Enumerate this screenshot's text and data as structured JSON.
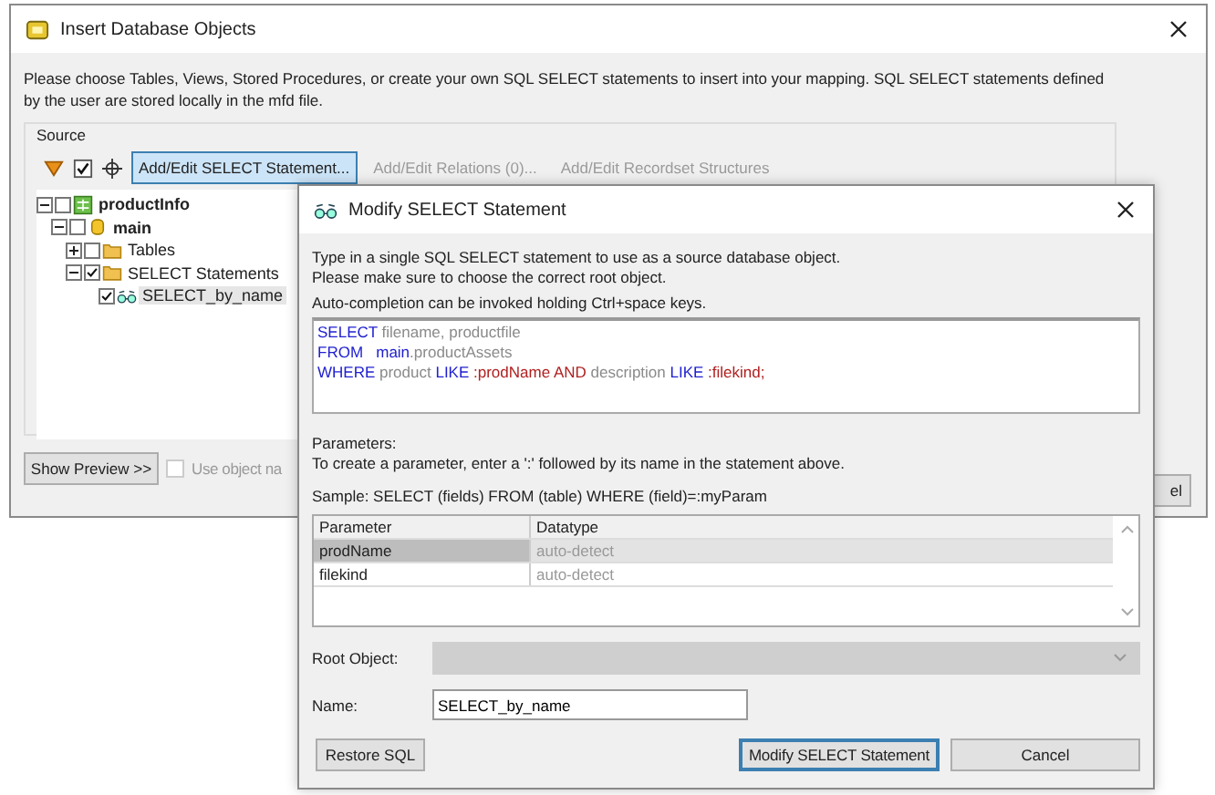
{
  "main_window": {
    "title": "Insert Database Objects",
    "description": "Please choose Tables, Views, Stored Procedures, or create your own SQL SELECT statements to insert into your mapping. SQL SELECT statements defined by the user are stored locally in the mfd file.",
    "source": {
      "label": "Source",
      "toolbar": [
        {
          "label": "Add/Edit SELECT Statement...",
          "disabled": false,
          "selected": true
        },
        {
          "label": "Add/Edit Relations (0)...",
          "disabled": true,
          "selected": false
        },
        {
          "label": "Add/Edit Recordset Structures",
          "disabled": true,
          "selected": false
        }
      ],
      "tree": [
        {
          "label": "productInfo",
          "kind": "database",
          "checked": false,
          "expanded": true,
          "selected": false,
          "children": [
            {
              "label": "main",
              "kind": "schema",
              "checked": false,
              "expanded": true,
              "selected": false,
              "children": [
                {
                  "label": "Tables",
                  "kind": "folder",
                  "checked": false,
                  "expanded": false,
                  "selected": false
                },
                {
                  "label": "SELECT Statements",
                  "kind": "folder",
                  "checked": true,
                  "expanded": true,
                  "selected": false,
                  "children": [
                    {
                      "label": "SELECT_by_name",
                      "kind": "query",
                      "checked": true,
                      "selected": true
                    }
                  ]
                }
              ]
            }
          ]
        }
      ]
    },
    "show_preview_button": "Show Preview >>",
    "use_object_checkbox": {
      "label": "Use object na",
      "checked": false,
      "disabled": true
    },
    "partial_button": "el"
  },
  "dialog": {
    "title": "Modify SELECT Statement",
    "instructions": [
      "Type in a single SQL SELECT statement to use as a source database object.",
      "Please make sure to choose the correct root object."
    ],
    "autocomplete_hint": "Auto-completion can be invoked holding Ctrl+space keys.",
    "sql_lines": [
      [
        {
          "text": "SELECT",
          "kind": "keyword"
        },
        {
          "text": " filename, productfile",
          "kind": "plain"
        }
      ],
      [
        {
          "text": "FROM",
          "kind": "keyword"
        },
        {
          "text": "   main",
          "kind": "keyword"
        },
        {
          "text": ".productAssets",
          "kind": "plain"
        }
      ],
      [
        {
          "text": "WHERE",
          "kind": "keyword"
        },
        {
          "text": " product ",
          "kind": "plain"
        },
        {
          "text": "LIKE",
          "kind": "keyword"
        },
        {
          "text": " :prodName AND",
          "kind": "param"
        },
        {
          "text": " description ",
          "kind": "plain"
        },
        {
          "text": "LIKE",
          "kind": "keyword"
        },
        {
          "text": " :filekind;",
          "kind": "param"
        }
      ]
    ],
    "parameters_label": "Parameters:",
    "parameters_hint": "To create a parameter, enter a ':' followed by its name in the statement above.",
    "sample": "Sample: SELECT (fields) FROM (table) WHERE (field)=:myParam",
    "table": {
      "columns": [
        "Parameter",
        "Datatype"
      ],
      "rows": [
        {
          "name": "prodName",
          "datatype": "auto-detect",
          "selected": true
        },
        {
          "name": "filekind",
          "datatype": "auto-detect",
          "selected": false
        }
      ]
    },
    "root_object": {
      "label": "Root Object:",
      "disabled": true
    },
    "name": {
      "label": "Name:",
      "value": "SELECT_by_name"
    },
    "buttons": [
      {
        "label": "Restore SQL",
        "default": false
      },
      {
        "label": "Modify SELECT Statement",
        "default": true
      },
      {
        "label": "Cancel",
        "default": false
      }
    ]
  }
}
